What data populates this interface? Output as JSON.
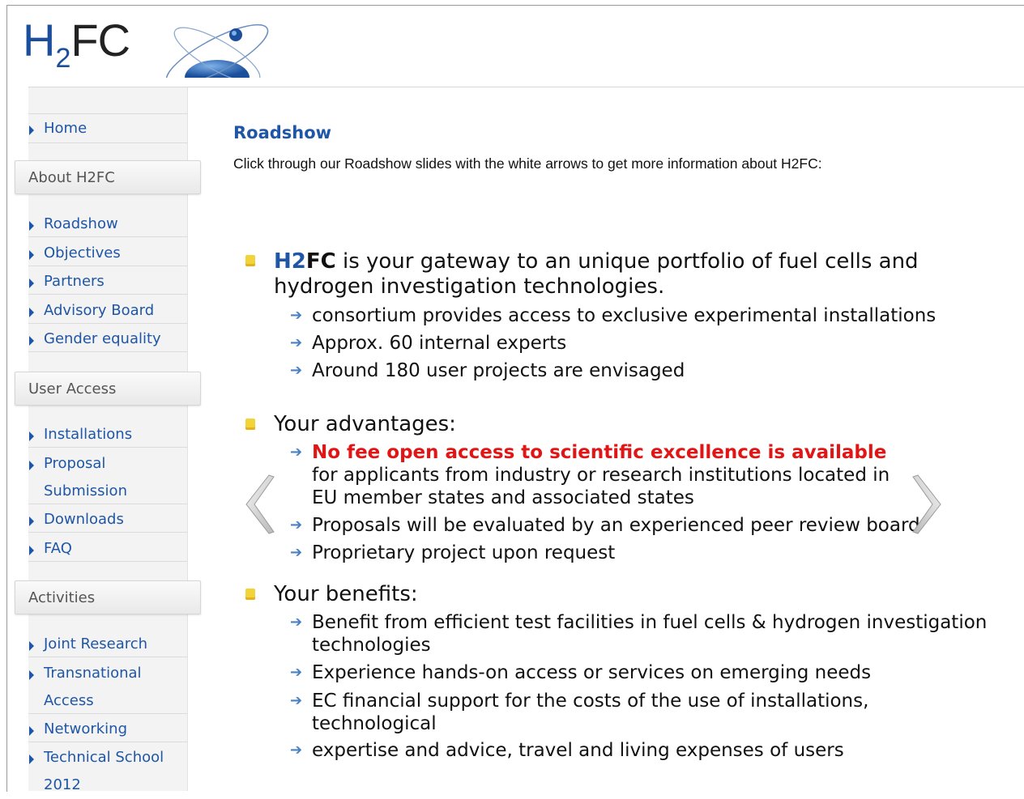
{
  "logo": {
    "h": "H",
    "sub": "2",
    "fc": "FC"
  },
  "sidebar": {
    "home": "Home",
    "sections": [
      {
        "title": "About H2FC",
        "items": [
          "Roadshow",
          "Objectives",
          "Partners",
          "Advisory Board",
          "Gender equality"
        ]
      },
      {
        "title": "User Access",
        "items": [
          "Installations",
          "Proposal Submission",
          "Downloads",
          "FAQ"
        ]
      },
      {
        "title": "Activities",
        "items": [
          "Joint Research",
          "Transnational Access",
          "Networking",
          "Technical School 2012"
        ]
      }
    ],
    "labels": {
      "home": "Home",
      "about": "About H2FC",
      "roadshow": "Roadshow",
      "objectives": "Objectives",
      "partners": "Partners",
      "advisory": "Advisory Board",
      "gender": "Gender equality",
      "user_access": "User Access",
      "installations": "Installations",
      "proposal_1": "Proposal",
      "proposal_2": "Submission",
      "downloads": "Downloads",
      "faq": "FAQ",
      "activities": "Activities",
      "joint": "Joint Research",
      "trans_1": "Transnational",
      "trans_2": "Access",
      "networking": "Networking",
      "tech_1": "Technical School",
      "tech_2": "2012"
    }
  },
  "main": {
    "title": "Roadshow",
    "intro": "Click through our Roadshow slides with the white arrows to get more information about H2FC:",
    "slide": {
      "h1_a": "H2",
      "h1_b": "FC",
      "h1_rest": " is your gateway to an unique portfolio of fuel cells and",
      "h1_line2": "hydrogen investigation technologies.",
      "items1": [
        "consortium provides access to exclusive experimental installations",
        "Approx. 60 internal experts",
        "Around 180 user projects are envisaged"
      ],
      "h2": "Your advantages:",
      "adv_red": "No fee open access to scientific excellence is available",
      "adv_line2": "for applicants from industry or research institutions located in",
      "adv_line3": "EU member states and associated states",
      "adv_items": [
        "Proposals will be evaluated by an experienced peer review board",
        "Proprietary project upon request"
      ],
      "h3": "Your benefits:",
      "ben1_line1": "Benefit from efficient test facilities in fuel cells & hydrogen investigation",
      "ben1_line2": "technologies",
      "ben2": "Experience hands-on access or services on emerging needs",
      "ben3_line1": "EC financial support for the costs of the use of installations,",
      "ben3_line2": "technological",
      "ben4": "expertise and advice, travel and living expenses of users"
    }
  },
  "colors": {
    "link": "#1f56a6",
    "highlight": "#e01515",
    "bullet": "#f2d33a"
  }
}
